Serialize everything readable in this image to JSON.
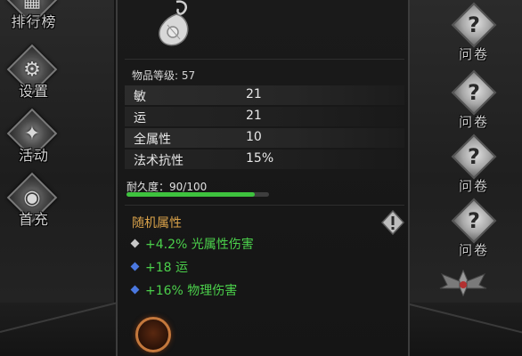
{
  "left_menu": {
    "items": [
      {
        "label": "排行榜",
        "icon": "leaderboard-icon",
        "glyph": "▦"
      },
      {
        "label": "设置",
        "icon": "gear-icon",
        "glyph": "⚙"
      },
      {
        "label": "活动",
        "icon": "gift-icon",
        "glyph": "✦"
      },
      {
        "label": "首充",
        "icon": "money-bag-icon",
        "glyph": "◉"
      }
    ]
  },
  "right_menu": {
    "surveys": [
      {
        "label": "问卷",
        "icon": "question-icon",
        "glyph": "?"
      },
      {
        "label": "问卷",
        "icon": "question-icon",
        "glyph": "?"
      },
      {
        "label": "问卷",
        "icon": "question-icon",
        "glyph": "?"
      },
      {
        "label": "问卷",
        "icon": "question-icon",
        "glyph": "?"
      }
    ],
    "emblem_icon": "winged-emblem-icon"
  },
  "item": {
    "icon": "pouch-icon",
    "level_text": "物品等级: 57",
    "stats": [
      {
        "name": "敏",
        "value": "21"
      },
      {
        "name": "运",
        "value": "21"
      },
      {
        "name": "全属性",
        "value": "10"
      },
      {
        "name": "法术抗性",
        "value": "15%"
      }
    ],
    "durability_text": "耐久度：90/100",
    "durability_fraction": 0.9,
    "random_title": "随机属性",
    "warning_icon": "warning-icon",
    "affixes": [
      {
        "text": "+4.2%  光属性伤害",
        "gem_color": "#c8c8c8"
      },
      {
        "text": "+18  运",
        "gem_color": "#4a78e0"
      },
      {
        "text": "+16%  物理伤害",
        "gem_color": "#4a78e0"
      }
    ],
    "orb_icon": "fire-orb-icon"
  },
  "colors": {
    "accent_gold": "#d9a24a",
    "affix_green": "#4bd04b",
    "durability_green": "#3ec23e"
  }
}
